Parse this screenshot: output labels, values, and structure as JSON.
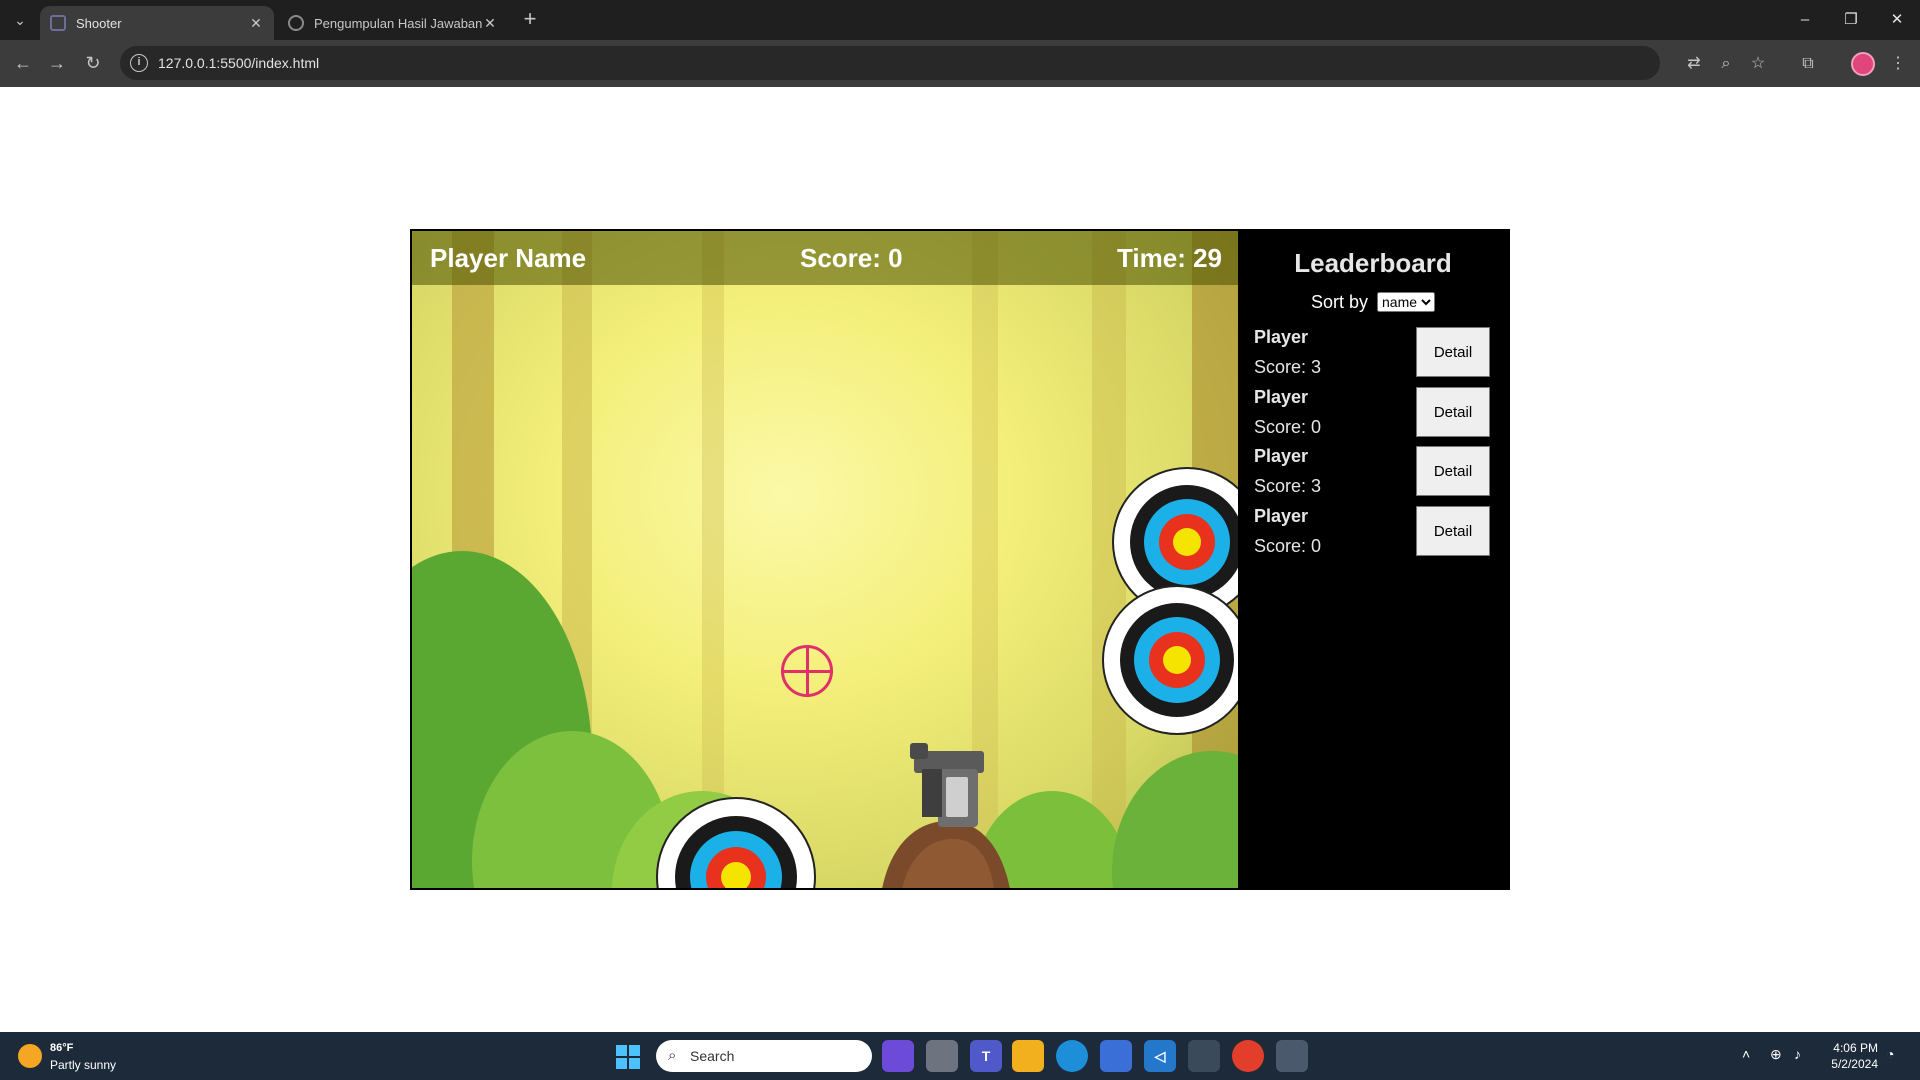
{
  "browser": {
    "tabs": [
      {
        "title": "Shooter",
        "active": true
      },
      {
        "title": "Pengumpulan Hasil Jawaban LK",
        "active": false
      }
    ],
    "url": "127.0.0.1:5500/index.html",
    "icons": {
      "tab_search": "chevron-down-icon",
      "new_tab": "plus-icon",
      "back": "arrow-left-icon",
      "forward": "arrow-right-icon",
      "reload": "reload-icon",
      "translate": "translate-icon",
      "zoom": "zoom-icon",
      "bookmark": "star-icon",
      "extensions": "puzzle-icon",
      "menu": "kebab-icon"
    }
  },
  "game": {
    "hud": {
      "player_name": "Player Name",
      "score": "Score: 0",
      "time": "Time: 29"
    }
  },
  "leaderboard": {
    "title": "Leaderboard",
    "sort_label": "Sort by",
    "sort_value": "name",
    "entries": [
      {
        "name": "Player",
        "score": "Score: 3",
        "button": "Detail"
      },
      {
        "name": "Player",
        "score": "Score: 0",
        "button": "Detail"
      },
      {
        "name": "Player",
        "score": "Score: 3",
        "button": "Detail"
      },
      {
        "name": "Player",
        "score": "Score: 0",
        "button": "Detail"
      }
    ]
  },
  "taskbar": {
    "weather": {
      "temp": "86°F",
      "desc": "Partly sunny"
    },
    "search_placeholder": "Search",
    "clock": {
      "time": "4:06 PM",
      "date": "5/2/2024"
    }
  },
  "colors": {
    "accent_pink": "#e0306a",
    "target_blue": "#1bb0e8",
    "target_red": "#e8321e",
    "target_yellow": "#f5e400"
  }
}
